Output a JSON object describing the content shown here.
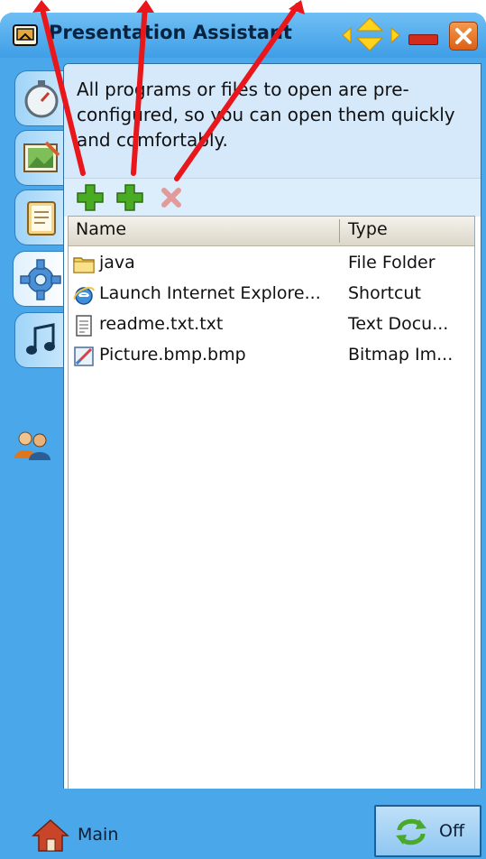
{
  "window": {
    "title": "Presentation Assistant"
  },
  "titlebar_icons": {
    "app": "presentation-assistant-icon",
    "nav_left": "arrow-left-icon",
    "nav_center": "arrow-up-down-icon",
    "nav_right": "arrow-right-icon",
    "minimize": "minimize-icon",
    "close": "close-icon"
  },
  "side_tabs": [
    {
      "icon": "stopwatch-icon",
      "active": false
    },
    {
      "icon": "image-edit-icon",
      "active": false
    },
    {
      "icon": "notepad-icon",
      "active": false
    },
    {
      "icon": "gear-icon",
      "active": true
    },
    {
      "icon": "music-icon",
      "active": false
    }
  ],
  "side_extra_icon": "users-icon",
  "panel": {
    "description": "All programs or files to open are pre-configured, so you can open them quickly and comfortably."
  },
  "toolbar": {
    "add_program_icon": "add-icon",
    "add_file_icon": "add-icon",
    "delete_icon": "delete-icon"
  },
  "list": {
    "columns": [
      "Name",
      "Type"
    ],
    "rows": [
      {
        "name": "java",
        "type": "File Folder",
        "icon": "folder-icon"
      },
      {
        "name": "Launch Internet Explore...",
        "type": "Shortcut",
        "icon": "internet-explorer-icon"
      },
      {
        "name": "readme.txt.txt",
        "type": "Text Docu...",
        "icon": "text-document-icon"
      },
      {
        "name": "Picture.bmp.bmp",
        "type": "Bitmap Im...",
        "icon": "bitmap-image-icon"
      }
    ]
  },
  "footer": {
    "main_label": "Main",
    "off_label": "Off"
  },
  "colors": {
    "frame": "#4aa7ea",
    "description_bg": "#d6e9fb",
    "annotation_arrow": "#e8171c",
    "add_green": "#3a9a1c",
    "delete_red": "#e06a6a"
  }
}
